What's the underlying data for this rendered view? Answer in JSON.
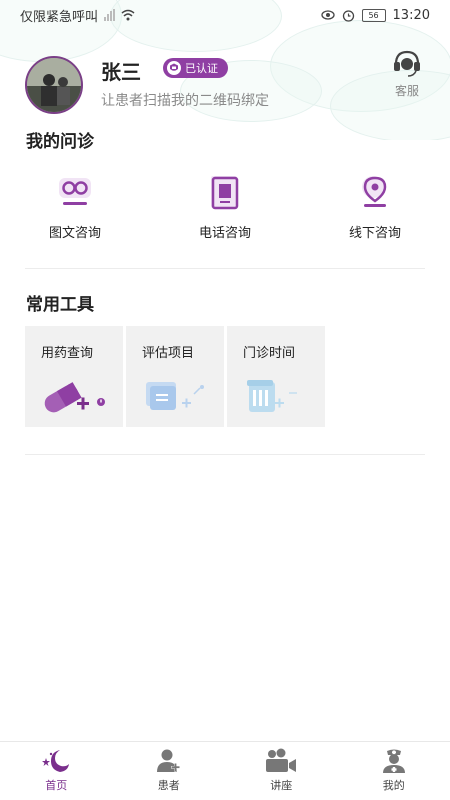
{
  "status_bar": {
    "carrier_text": "仅限紧急呼叫",
    "battery": "56",
    "time": "13:20"
  },
  "profile": {
    "name": "张三",
    "badge": "已认证",
    "subtitle": "让患者扫描我的二维码绑定",
    "service_label": "客服"
  },
  "consultation": {
    "title": "我的问诊",
    "items": [
      {
        "label": "图文咨询",
        "icon": "chat-icon"
      },
      {
        "label": "电话咨询",
        "icon": "phone-icon"
      },
      {
        "label": "线下咨询",
        "icon": "location-pin-icon"
      }
    ]
  },
  "tools": {
    "title": "常用工具",
    "items": [
      {
        "label": "用药查询",
        "icon": "pill-icon"
      },
      {
        "label": "评估项目",
        "icon": "chat-bubble-icon"
      },
      {
        "label": "门诊时间",
        "icon": "calendar-icon"
      }
    ]
  },
  "tabbar": {
    "items": [
      {
        "label": "首页",
        "icon": "moon-star-icon",
        "active": true
      },
      {
        "label": "患者",
        "icon": "person-add-icon",
        "active": false
      },
      {
        "label": "讲座",
        "icon": "video-icon",
        "active": false
      },
      {
        "label": "我的",
        "icon": "nurse-icon",
        "active": false
      }
    ]
  },
  "colors": {
    "accent": "#8f3fa3",
    "tool_bg": "#f1f1f1"
  }
}
